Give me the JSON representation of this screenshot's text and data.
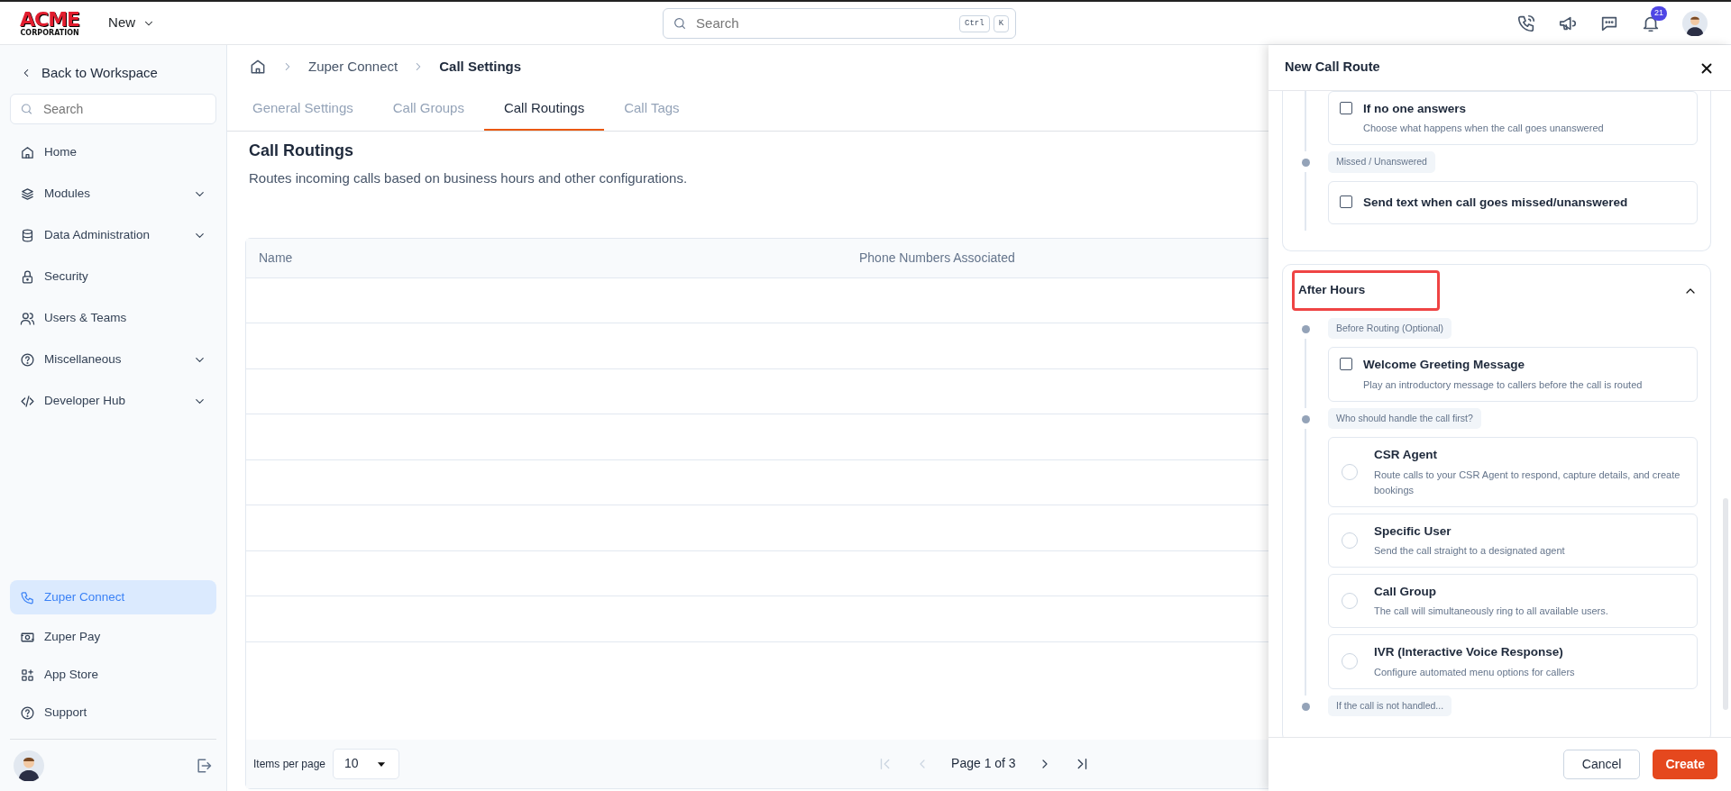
{
  "topbar": {
    "logo": "ACME",
    "logo_sub": "CORPORATION",
    "new_menu": "New",
    "search": {
      "placeholder": "Search"
    },
    "shortcut": [
      "Ctrl",
      "K"
    ],
    "notification_count": "21"
  },
  "sidebar": {
    "back": "Back to Workspace",
    "search": {
      "placeholder": "Search"
    },
    "items": [
      {
        "label": "Home",
        "expandable": false,
        "selected": false
      },
      {
        "label": "Modules",
        "expandable": true,
        "selected": false
      },
      {
        "label": "Data Administration",
        "expandable": true,
        "selected": false
      },
      {
        "label": "Security",
        "expandable": false,
        "selected": false
      },
      {
        "label": "Users & Teams",
        "expandable": false,
        "selected": false
      },
      {
        "label": "Miscellaneous",
        "expandable": true,
        "selected": false
      },
      {
        "label": "Developer Hub",
        "expandable": true,
        "selected": false
      }
    ],
    "bottom_items": [
      {
        "label": "Zuper Connect",
        "selected": true
      },
      {
        "label": "Zuper Pay",
        "selected": false
      },
      {
        "label": "App Store",
        "selected": false
      },
      {
        "label": "Support",
        "selected": false
      }
    ]
  },
  "breadcrumb": [
    "Zuper Connect",
    "Call Settings"
  ],
  "tabs": [
    {
      "label": "General Settings",
      "selected": false
    },
    {
      "label": "Call Groups",
      "selected": false
    },
    {
      "label": "Call Routings",
      "selected": true
    },
    {
      "label": "Call Tags",
      "selected": false
    }
  ],
  "page": {
    "title": "Call Routings",
    "subtitle": "Routes incoming calls based on business hours and other configurations."
  },
  "table": {
    "columns": [
      "Name",
      "Phone Numbers Associated"
    ]
  },
  "pagination": {
    "items_per_page_label": "Items per page",
    "items_per_page": "10",
    "page_label": "Page 1 of 3"
  },
  "drawer": {
    "title": "New Call Route",
    "sections": [
      {
        "steps": [
          {
            "options": [
              {
                "kind": "checkbox",
                "title": "If no one answers",
                "description": "Choose what happens when the call goes unanswered",
                "checked": false
              }
            ]
          },
          {
            "label": "Missed / Unanswered",
            "options": [
              {
                "kind": "checkbox",
                "title": "Send text when call goes missed/unanswered",
                "checked": false
              }
            ]
          }
        ]
      },
      {
        "title": "After Hours",
        "expanded": true,
        "highlighted": true,
        "steps": [
          {
            "label": "Before Routing (Optional)",
            "options": [
              {
                "kind": "checkbox",
                "title": "Welcome Greeting Message",
                "description": "Play an introductory message to callers before the call is routed",
                "checked": false
              }
            ]
          },
          {
            "label": "Who should handle the call first?",
            "options": [
              {
                "kind": "radio",
                "title": "CSR Agent",
                "description": "Route calls to your CSR Agent to respond, capture details, and create bookings",
                "selected": false
              },
              {
                "kind": "radio",
                "title": "Specific User",
                "description": "Send the call straight to a designated agent",
                "selected": false
              },
              {
                "kind": "radio",
                "title": "Call Group",
                "description": "The call will simultaneously ring to all available users.",
                "selected": false
              },
              {
                "kind": "radio",
                "title": "IVR (Interactive Voice Response)",
                "description": "Configure automated menu options for callers",
                "selected": false
              }
            ]
          },
          {
            "label": "If the call is not handled..."
          }
        ]
      }
    ],
    "buttons": [
      {
        "kind": "secondary",
        "label": "Cancel"
      },
      {
        "kind": "primary",
        "label": "Create"
      }
    ]
  }
}
